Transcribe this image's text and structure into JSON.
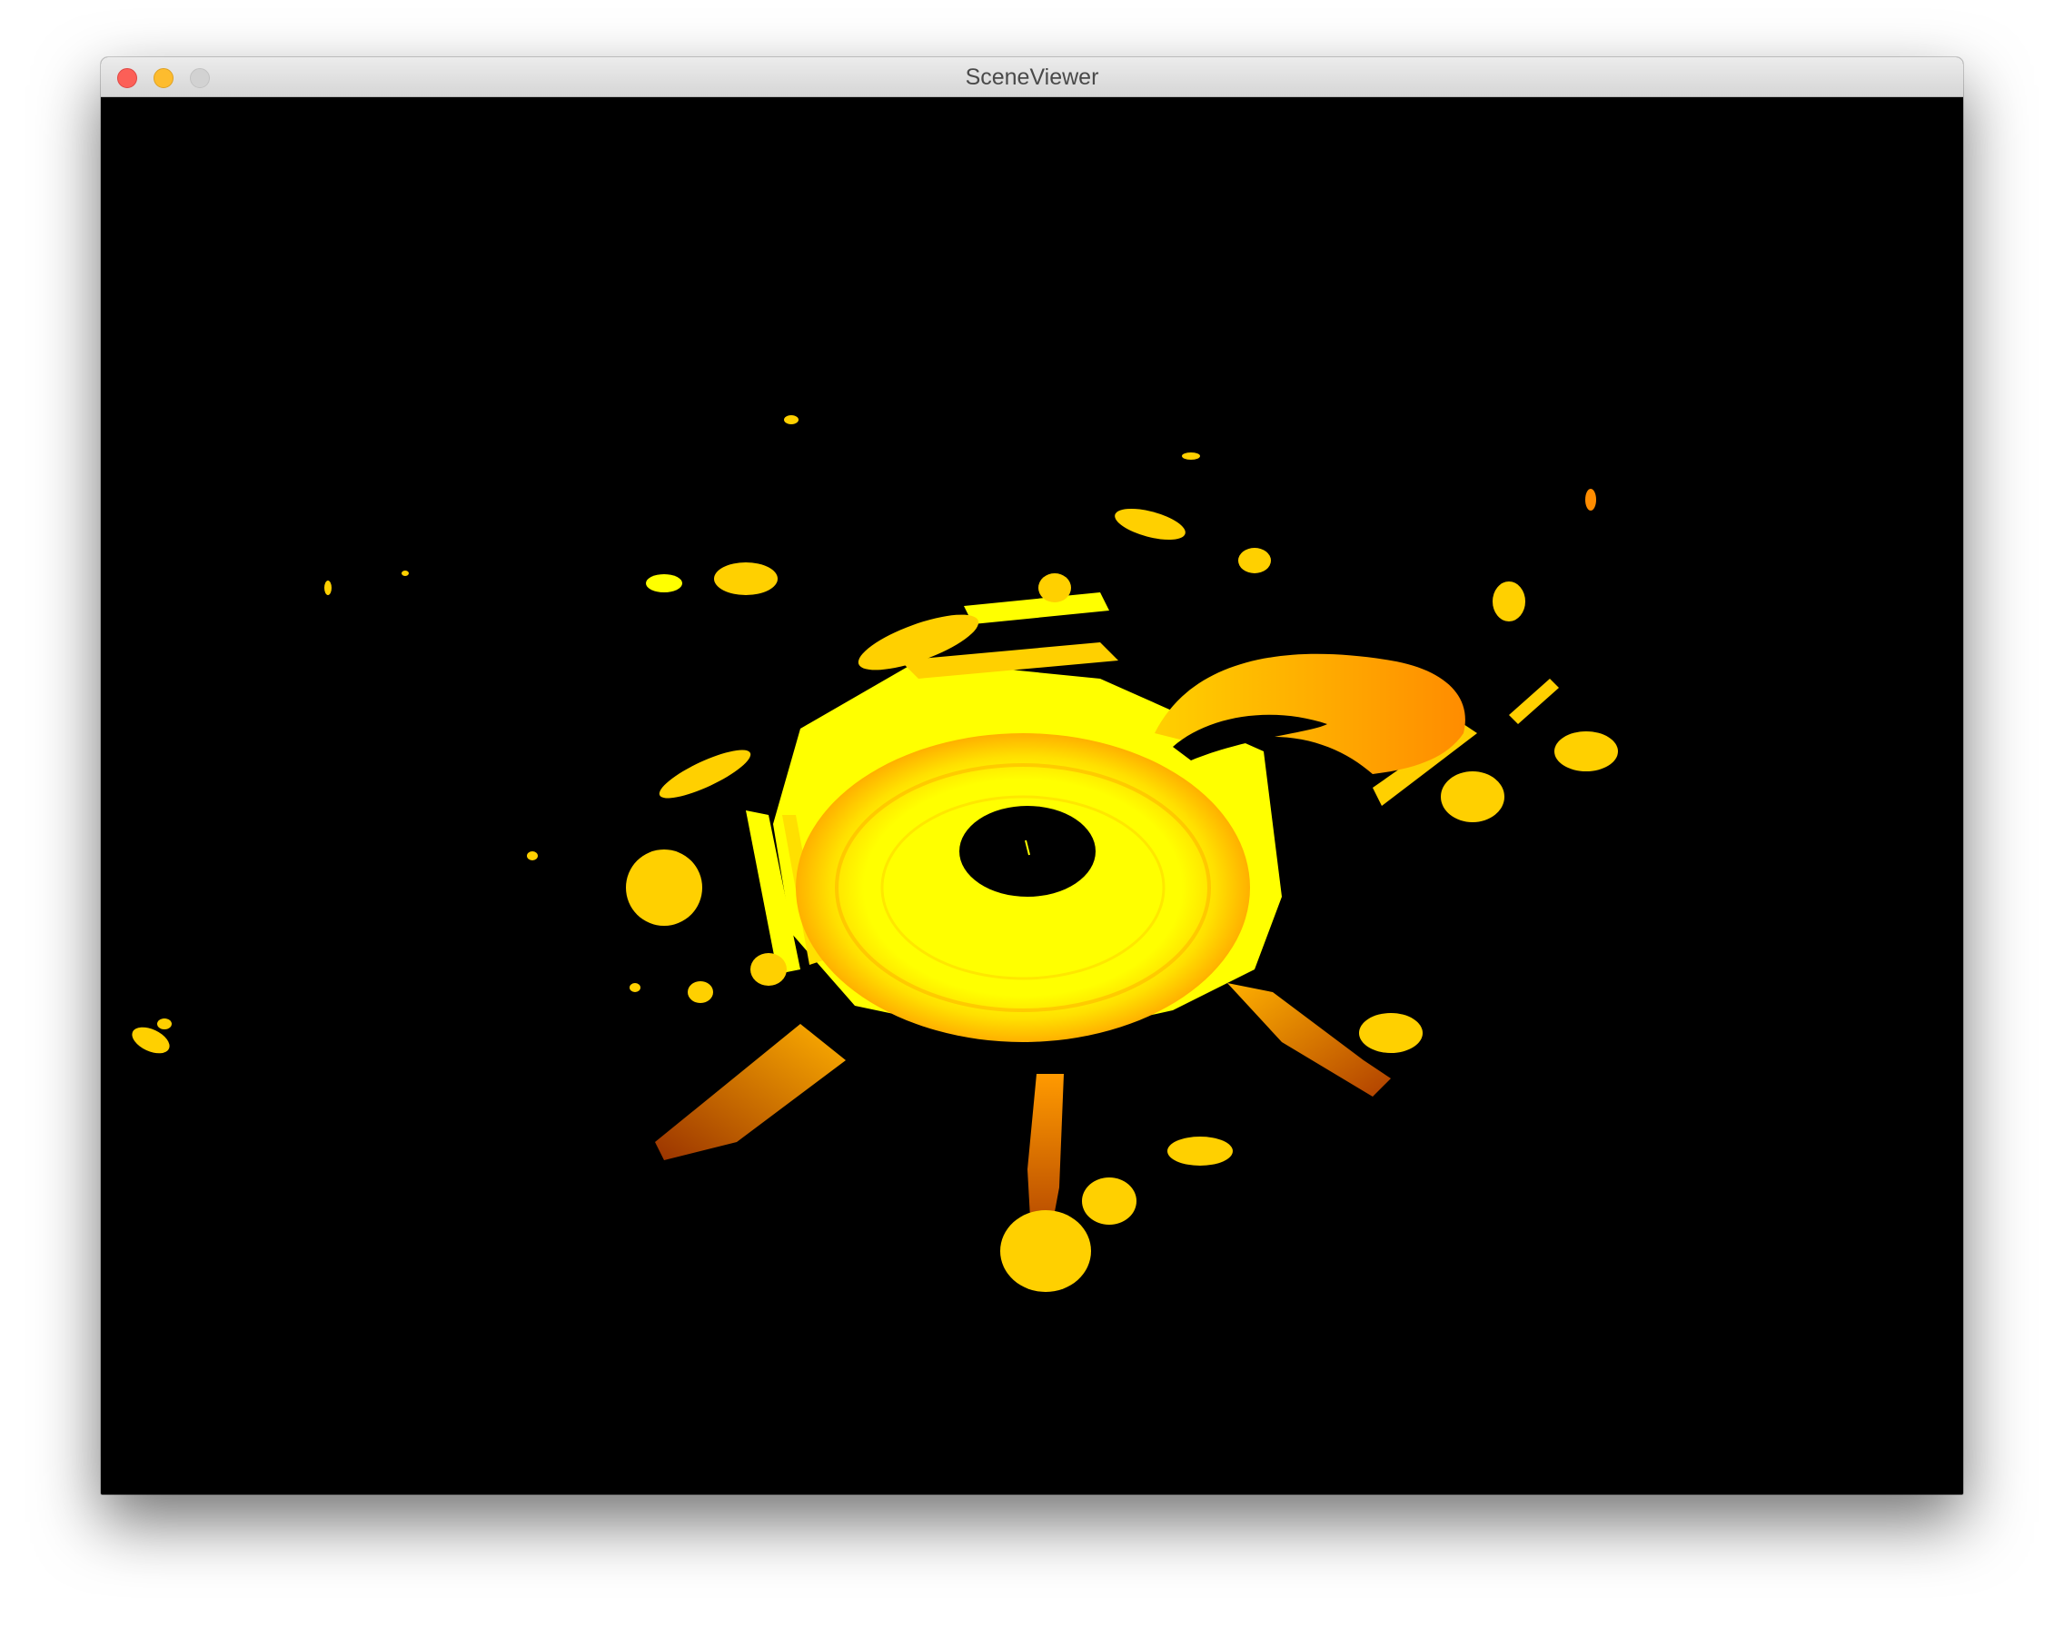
{
  "window": {
    "title": "SceneViewer",
    "controls": {
      "close": "close-icon",
      "minimize": "minimize-icon",
      "zoom": "zoom-icon"
    }
  },
  "viewport": {
    "background": "#000000",
    "colors": {
      "bright": "#ffff00",
      "mid": "#ffd000",
      "orange": "#ff8c00",
      "dark": "#c24a00",
      "hole": "#000000"
    }
  }
}
